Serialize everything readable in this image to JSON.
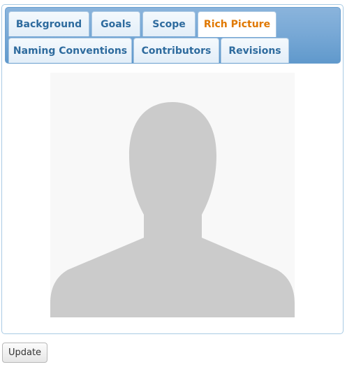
{
  "tabs": {
    "row1": [
      {
        "label": "Background",
        "active": false
      },
      {
        "label": "Goals",
        "active": false
      },
      {
        "label": "Scope",
        "active": false
      },
      {
        "label": "Rich Picture",
        "active": true
      }
    ],
    "row2": [
      {
        "label": "Naming Conventions",
        "active": false
      },
      {
        "label": "Contributors",
        "active": false
      },
      {
        "label": "Revisions",
        "active": false
      }
    ]
  },
  "content": {
    "image_icon": "person-silhouette-placeholder"
  },
  "actions": {
    "update_label": "Update"
  },
  "colors": {
    "active_tab_text": "#e07800",
    "tab_text": "#2e6b9e",
    "tabbar_bg": "#79a9d6",
    "silhouette": "#cbcbcb"
  }
}
